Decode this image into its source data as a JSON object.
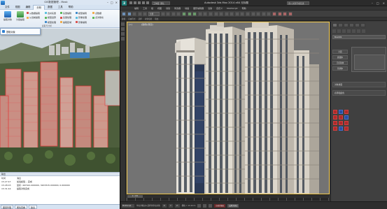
{
  "left_app": {
    "title": "GIS数据管理 - Mask",
    "menu_tabs": [
      "文件",
      "视图",
      "编辑",
      "分析",
      "数据",
      "工具",
      "帮助"
    ],
    "active_tab": "分析",
    "ribbon": {
      "big_buttons": [
        "提取对象",
        "分层提取"
      ],
      "col1": [
        "从数据提取",
        "从当前提取"
      ],
      "col2": [
        "合并矢量",
        "模型运算",
        "模型处理"
      ],
      "col3": [
        "矢量编辑",
        "矢量处理",
        "提取区域"
      ],
      "col4": [
        "模型编辑",
        "影像处理",
        "影像编辑"
      ],
      "col5": [
        "点数据",
        "点对象化"
      ],
      "group_label": "提取与分析"
    },
    "dropdown_item": "提取对象",
    "log": {
      "header": "输出",
      "columns": [
        "时间",
        "消息"
      ],
      "rows": [
        {
          "time": "15:27:47",
          "msg": "加载模型... 完成"
        },
        {
          "time": "15:28:03",
          "msg": "坐标: 497421.000000, 3203315.000000, 0.000000"
        },
        {
          "time": "15:31:44",
          "msg": "提取对象完成"
        }
      ]
    },
    "status_tabs": [
      "图层管理",
      "属性查看",
      "输出"
    ]
  },
  "max_app": {
    "logo": "3",
    "workspace": "工作区: 默认",
    "title": "Autodesk 3ds Max 2014 x64    无标题",
    "search_placeholder": "键入关键字或短语",
    "menu": [
      "编辑",
      "工具",
      "组",
      "视图",
      "创建",
      "修改器",
      "动画",
      "图形编辑器",
      "渲染",
      "自定义",
      "MAXScript",
      "帮助"
    ],
    "toolbar_select": "全部",
    "ribbon_tabs": [
      "建模",
      "自由形式",
      "选择",
      "对象绘制",
      "填充"
    ],
    "viewport": {
      "label": "[+]",
      "view_name": "[透视][真实]"
    },
    "command_panel": {
      "object_name": "Box001",
      "rollout_title": "对象类型",
      "buttons": [
        "平面",
        "圆锥体",
        "几何球体",
        "管状体"
      ],
      "name_color": "名称和颜色"
    },
    "timeline": "0 / 100",
    "status": {
      "script": "MAXScript",
      "message": "单击并拖动以选择并移动对象",
      "x": "X:",
      "y": "Y:",
      "z": "Z:",
      "grid": "栅格 = 10.0mm",
      "auto_key": "自动关键点",
      "set_key": "设置关键点"
    }
  },
  "colors": {
    "accent": "#f2c94c",
    "red_wire": "#e03a3a",
    "max_bg": "#3a3a3a",
    "ribbon_bg": "#e2eaf4"
  }
}
